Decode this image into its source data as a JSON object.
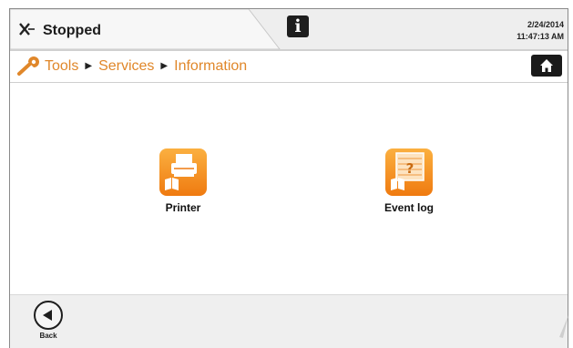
{
  "status": {
    "icon": "x-icon",
    "text": "Stopped",
    "date": "2/24/2014",
    "time": "11:47:13 AM"
  },
  "toolbar": {
    "info_icon": "info-icon",
    "info_glyph": "i",
    "home_icon": "home-icon"
  },
  "breadcrumb": {
    "icon": "wrench-icon",
    "items": [
      "Tools",
      "Services",
      "Information"
    ],
    "separator": "▶"
  },
  "tiles": [
    {
      "label": "Printer",
      "icon": "printer-icon"
    },
    {
      "label": "Event log",
      "icon": "event-log-icon"
    }
  ],
  "footer": {
    "back_label": "Back",
    "back_icon": "back-arrow-icon"
  },
  "colors": {
    "accent": "#e0872a",
    "tile_top": "#fbb040",
    "tile_bottom": "#ef7a10",
    "dark": "#1e1e1e"
  }
}
